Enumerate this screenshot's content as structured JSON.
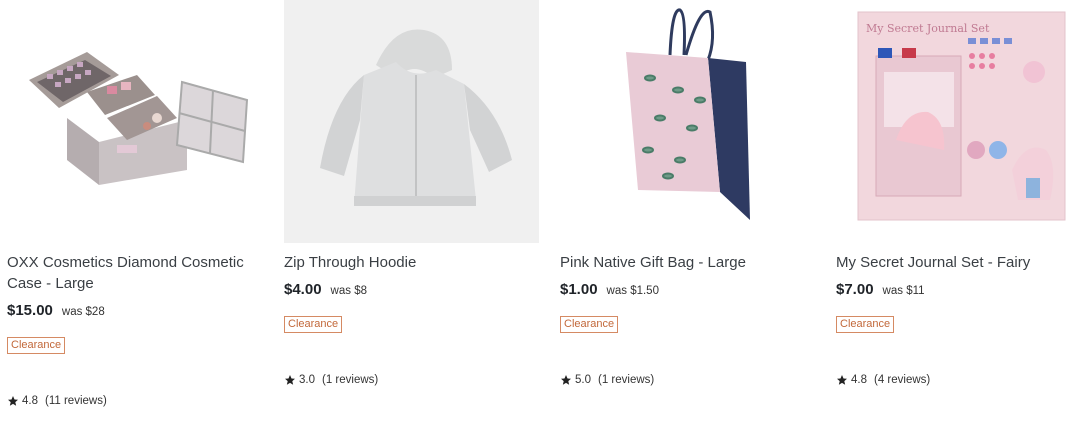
{
  "products": [
    {
      "title": "OXX Cosmetics Diamond Cosmetic Case - Large",
      "price": "$15.00",
      "was": "was $28",
      "badge": "Clearance",
      "rating": "4.8",
      "reviews": "(11 reviews)",
      "image": "cosmetic-case-image"
    },
    {
      "title": "Zip Through Hoodie",
      "price": "$4.00",
      "was": "was $8",
      "badge": "Clearance",
      "rating": "3.0",
      "reviews": "(1 reviews)",
      "image": "hoodie-image"
    },
    {
      "title": "Pink Native Gift Bag - Large",
      "price": "$1.00",
      "was": "was $1.50",
      "badge": "Clearance",
      "rating": "5.0",
      "reviews": "(1 reviews)",
      "image": "gift-bag-image"
    },
    {
      "title": "My Secret Journal Set - Fairy",
      "price": "$7.00",
      "was": "was $11",
      "badge": "Clearance",
      "rating": "4.8",
      "reviews": "(4 reviews)",
      "image": "journal-set-image",
      "image_text": "My Secret Journal Set"
    }
  ],
  "colors": {
    "badge": "#c2683a",
    "text": "#3a3f44",
    "price": "#1f2328"
  }
}
